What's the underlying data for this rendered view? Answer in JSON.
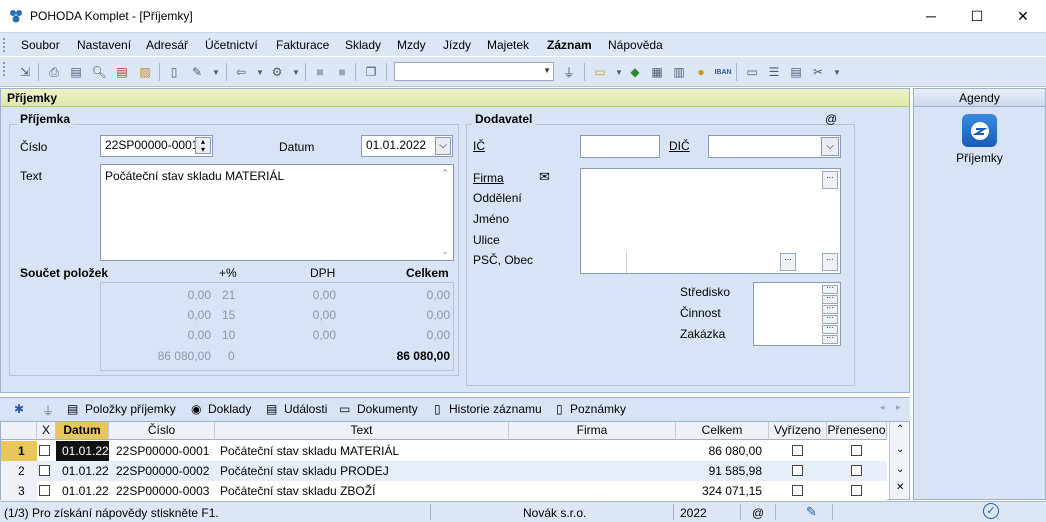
{
  "window": {
    "title": "POHODA Komplet - [Příjemky]",
    "minimize": "─",
    "maximize": "☐",
    "close": "✕"
  },
  "menu": [
    "Soubor",
    "Nastavení",
    "Adresář",
    "Účetnictví",
    "Fakturace",
    "Sklady",
    "Mzdy",
    "Jízdy",
    "Majetek",
    "Záznam",
    "Nápověda"
  ],
  "toolbar": {
    "combo_value": ""
  },
  "main": {
    "header": "Příjemky",
    "prijemka": {
      "group_label": "Příjemka",
      "cislo_label": "Číslo",
      "cislo_value": "22SP00000-0001",
      "datum_label": "Datum",
      "datum_value": "01.01.2022",
      "text_label": "Text",
      "text_value": "Počáteční stav skladu MATERIÁL"
    },
    "soucet": {
      "label": "Součet položek",
      "col_pct": "+%",
      "col_dph": "DPH",
      "col_celkem": "Celkem",
      "rows": [
        {
          "base": "0,00",
          "pct": "21",
          "dph": "0,00",
          "celkem": "0,00"
        },
        {
          "base": "0,00",
          "pct": "15",
          "dph": "0,00",
          "celkem": "0,00"
        },
        {
          "base": "0,00",
          "pct": "10",
          "dph": "0,00",
          "celkem": "0,00"
        },
        {
          "base": "86 080,00",
          "pct": "0",
          "dph": "",
          "celkem": "86 080,00"
        }
      ]
    },
    "dodavatel": {
      "group_label": "Dodavatel",
      "at": "@",
      "ic_label": "IČ",
      "dic_label": "DIČ",
      "firma": "Firma",
      "oddeleni": "Oddělení",
      "jmeno": "Jméno",
      "ulice": "Ulice",
      "psc": "PSČ, Obec",
      "stredisko": "Středisko",
      "cinnost": "Činnost",
      "zakazka": "Zakázka"
    }
  },
  "agenda": {
    "header": "Agendy",
    "item": "Příjemky"
  },
  "tabs": [
    "Položky příjemky",
    "Doklady",
    "Události",
    "Dokumenty",
    "Historie záznamu",
    "Poznámky"
  ],
  "grid": {
    "headers": [
      "X",
      "Datum",
      "Číslo",
      "Text",
      "Firma",
      "Celkem",
      "Vyřízeno",
      "Přeneseno"
    ],
    "rows": [
      {
        "n": "1",
        "datum": "01.01.22",
        "cislo": "22SP00000-0001",
        "text": "Počáteční stav skladu MATERIÁL",
        "firma": "",
        "celkem": "86 080,00"
      },
      {
        "n": "2",
        "datum": "01.01.22",
        "cislo": "22SP00000-0002",
        "text": "Počáteční stav skladu PRODEJ",
        "firma": "",
        "celkem": "91 585,98"
      },
      {
        "n": "3",
        "datum": "01.01.22",
        "cislo": "22SP00000-0003",
        "text": "Počáteční stav skladu ZBOŽÍ",
        "firma": "",
        "celkem": "324 071,15"
      }
    ]
  },
  "status": {
    "help": "(1/3) Pro získání nápovědy stiskněte F1.",
    "company": "Novák s.r.o.",
    "year": "2022",
    "at": "@"
  }
}
